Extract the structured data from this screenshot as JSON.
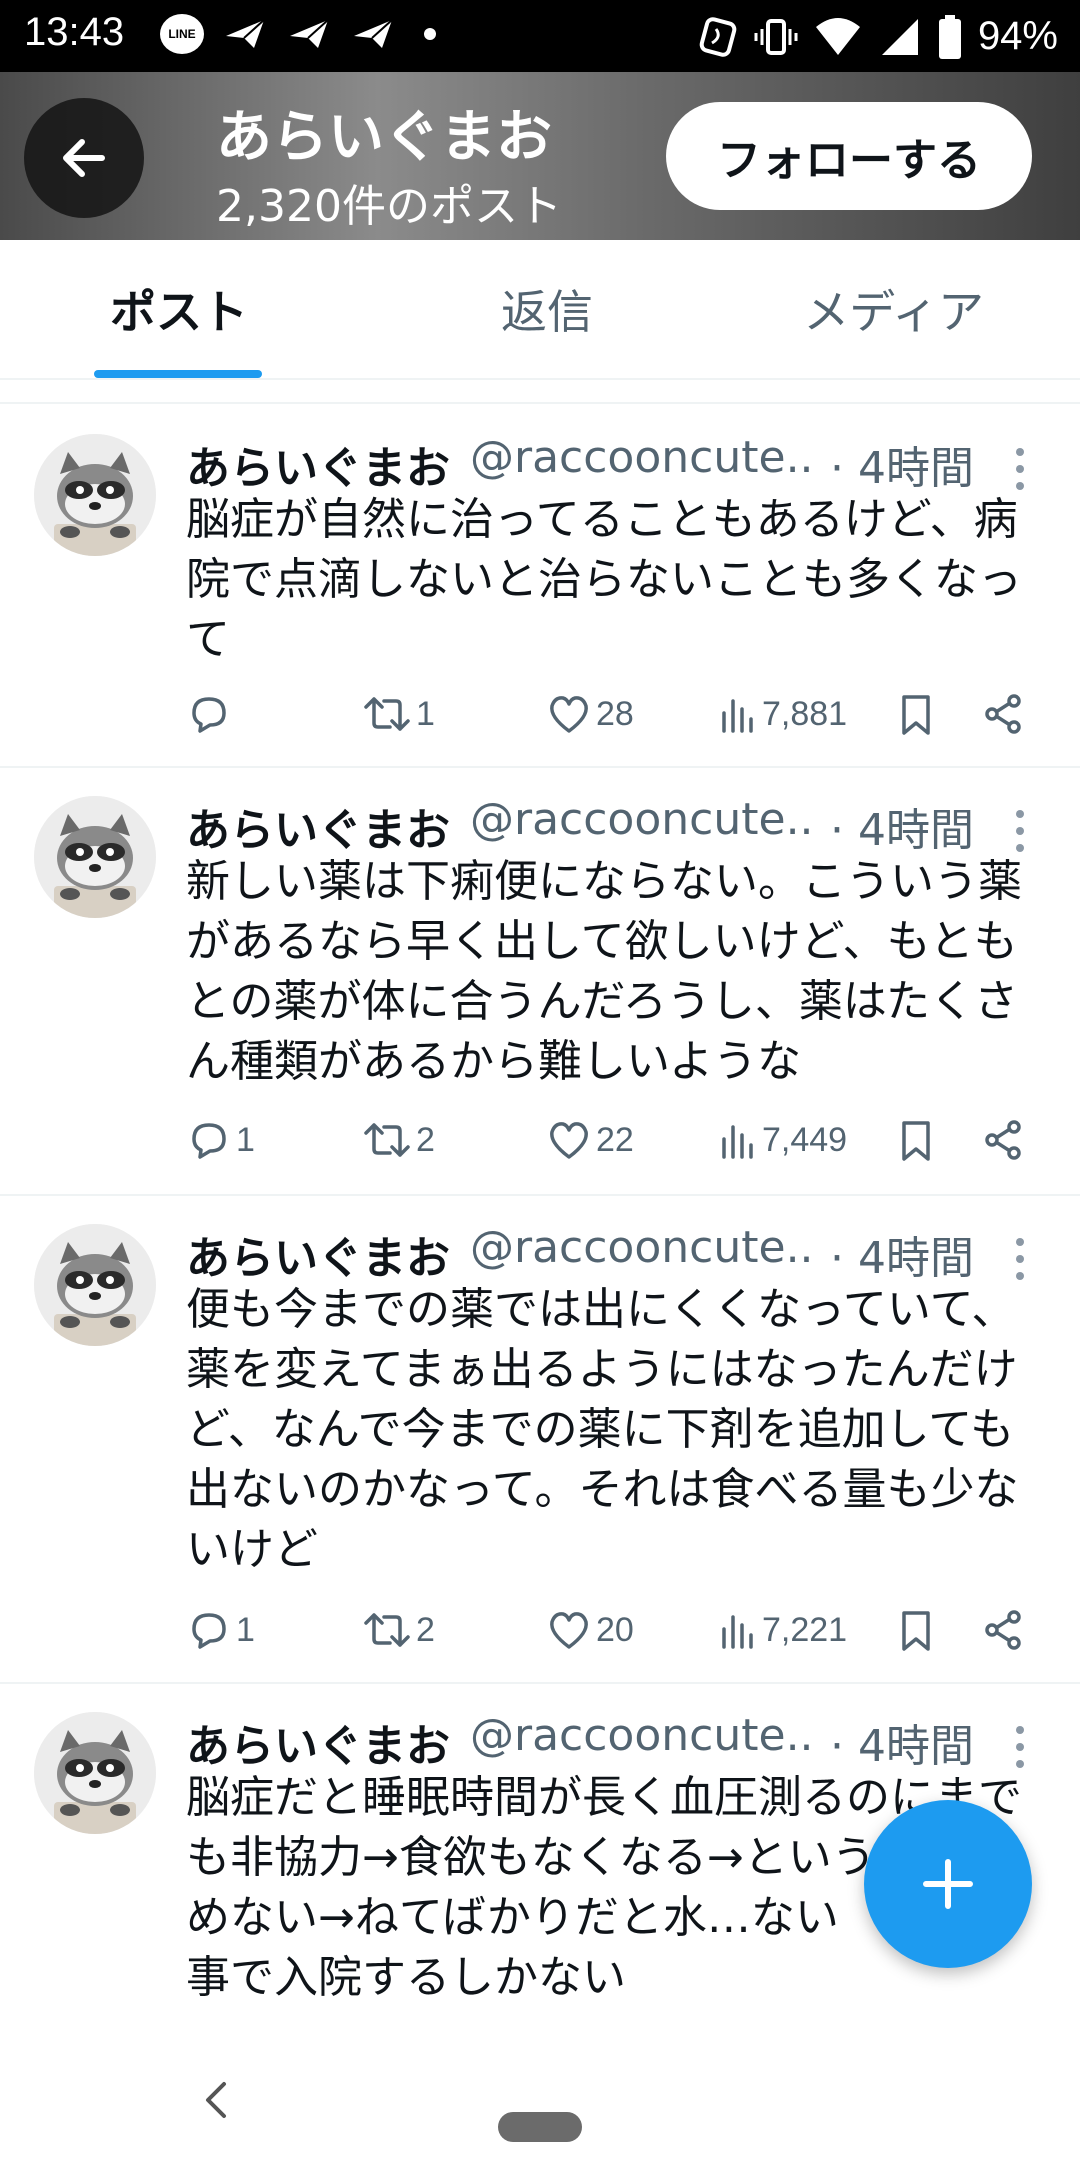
{
  "status_bar": {
    "time": "13:43",
    "line_label": "LINE",
    "battery": "94%"
  },
  "header": {
    "display_name": "あらいぐまお",
    "post_count": "2,320件のポスト",
    "follow_label": "フォローする"
  },
  "tabs": [
    {
      "label": "ポスト",
      "active": true
    },
    {
      "label": "返信",
      "active": false
    },
    {
      "label": "メディア",
      "active": false
    }
  ],
  "tweets": [
    {
      "name": "あらいぐまお",
      "handle": "@raccooncute...",
      "time": "· 4時間",
      "text": "脳症が自然に治ってることもあるけど、病院で点滴しないと治らないことも多くなって",
      "replies": "",
      "retweets": "1",
      "likes": "28",
      "views": "7,881"
    },
    {
      "name": "あらいぐまお",
      "handle": "@raccooncute...",
      "time": "· 4時間",
      "text": "新しい薬は下痢便にならない。こういう薬があるなら早く出して欲しいけど、もともとの薬が体に合うんだろうし、薬はたくさん種類があるから難しいような",
      "replies": "1",
      "retweets": "2",
      "likes": "22",
      "views": "7,449"
    },
    {
      "name": "あらいぐまお",
      "handle": "@raccooncute...",
      "time": "· 4時間",
      "text": "便も今までの薬では出にくくなっていて、薬を変えてまぁ出るようにはなったんだけど、なんで今までの薬に下剤を追加しても出ないのかなって。それは食べる量も少ないけど",
      "replies": "1",
      "retweets": "2",
      "likes": "20",
      "views": "7,221"
    },
    {
      "name": "あらいぐまお",
      "handle": "@raccooncute...",
      "time": "· 4時間",
      "text": "脳症だと睡眠時間が長く血圧測るのにまでも非協力→食欲もなくなる→という薬も飲めない→ねてばかりだと水…ない　という事で入院するしかない"
    }
  ],
  "icons": {
    "back": "arrow-left-icon",
    "reply": "comment-icon",
    "retweet": "retweet-icon",
    "like": "heart-icon",
    "views": "bar-chart-icon",
    "bookmark": "bookmark-icon",
    "share": "share-icon",
    "compose": "plus-icon"
  },
  "colors": {
    "accent": "#1d9bf0",
    "text": "#0f1419",
    "secondary": "#536471"
  }
}
